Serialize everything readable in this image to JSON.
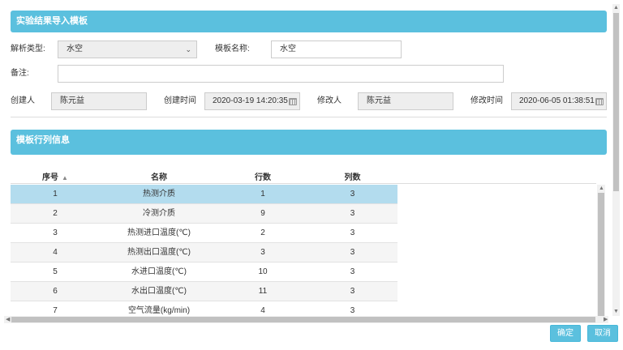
{
  "panel1": {
    "title": "实验结果导入模板"
  },
  "form": {
    "parse_type_label": "解析类型:",
    "parse_type_value": "水空",
    "template_name_label": "模板名称:",
    "template_name_value": "水空",
    "remark_label": "备注:",
    "remark_value": "",
    "creator_label": "创建人",
    "creator_value": "陈元益",
    "created_time_label": "创建时间",
    "created_time_value": "2020-03-19 14:20:35",
    "modifier_label": "修改人",
    "modifier_value": "陈元益",
    "modified_time_label": "修改时间",
    "modified_time_value": "2020-06-05 01:38:51"
  },
  "panel2": {
    "title": "模板行列信息"
  },
  "table": {
    "headers": [
      "序号",
      "名称",
      "行数",
      "列数"
    ],
    "rows": [
      {
        "no": "1",
        "name": "热测介质",
        "rows": "1",
        "cols": "3"
      },
      {
        "no": "2",
        "name": "冷测介质",
        "rows": "9",
        "cols": "3"
      },
      {
        "no": "3",
        "name": "热测进口温度(℃)",
        "rows": "2",
        "cols": "3"
      },
      {
        "no": "4",
        "name": "热测出口温度(℃)",
        "rows": "3",
        "cols": "3"
      },
      {
        "no": "5",
        "name": "水进口温度(℃)",
        "rows": "10",
        "cols": "3"
      },
      {
        "no": "6",
        "name": "水出口温度(℃)",
        "rows": "11",
        "cols": "3"
      },
      {
        "no": "7",
        "name": "空气流量(kg/min)",
        "rows": "4",
        "cols": "3"
      }
    ]
  },
  "buttons": {
    "confirm": "确定",
    "cancel": "取消"
  },
  "colors": {
    "accent": "#5bc0de",
    "selected_row": "#b3dcee"
  }
}
